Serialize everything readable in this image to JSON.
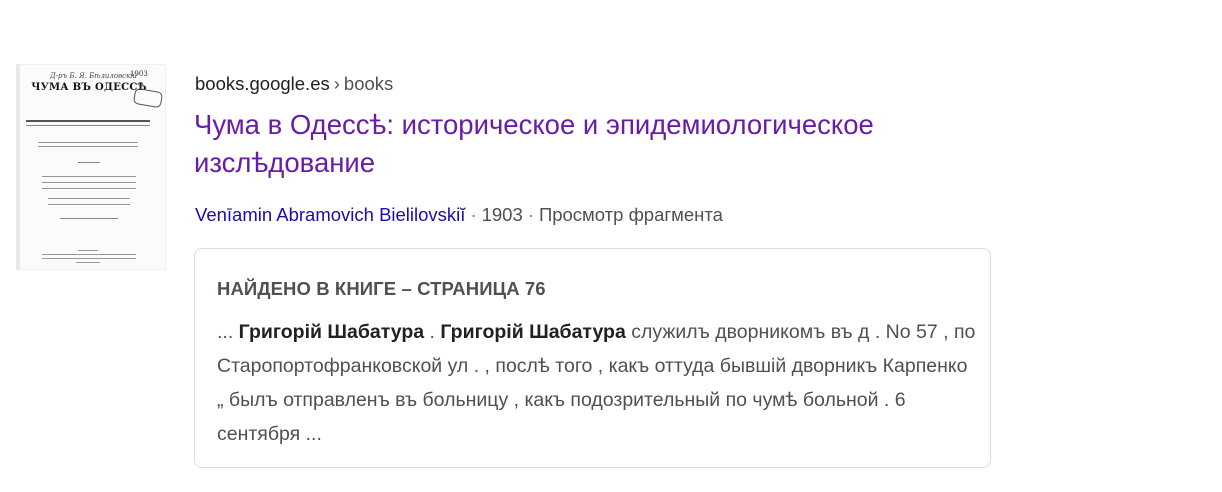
{
  "result": {
    "site": "books.google.es",
    "breadcrumb_separator": "›",
    "path": "books",
    "title": "Чума в Одессѣ: историческое и эпидемиологическое изслѣдование",
    "author": "Venīamin Abramovich Bielilovskiĭ",
    "year": "1903",
    "separator": "·",
    "preview_label": "Просмотр фрагмента",
    "thumbnail": {
      "small_text": "Д-ръ Б. Я. Бѣлиловскій",
      "number": "1903",
      "title_text": "ЧУМА ВЪ ОДЕССѢ"
    },
    "snippet_card": {
      "heading": "НАЙДЕНО В КНИГЕ – СТРАНИЦА 76",
      "ellipsis_start": "... ",
      "name_1": "Григорій Шабатура",
      "between": " . ",
      "name_2": "Григорій Шабатура",
      "text": " служилъ дворникомъ въ д . No 57 , по Старопортофранковской ул . , послѣ того , какъ оттуда бывшій дворникъ Карпенко „ былъ отправленъ въ больницу , какъ подозрительный по чумѣ больной . 6 сентября ..."
    }
  }
}
